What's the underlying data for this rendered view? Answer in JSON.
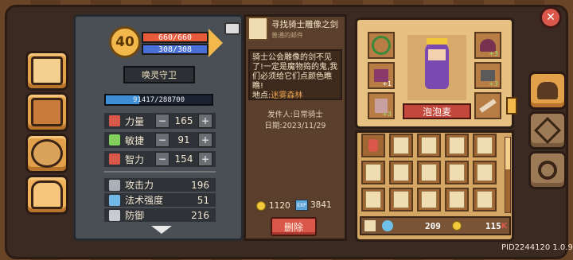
{
  "player": {
    "level": "40",
    "hp": "660/660",
    "mp": "308/308",
    "name": "唤灵守卫",
    "exp_text": "91417/288700",
    "exp_fraction": 0.317
  },
  "attributes": [
    {
      "label": "力量",
      "value": "165",
      "icon": "fist-icon",
      "color": "#d9574b"
    },
    {
      "label": "敏捷",
      "value": "91",
      "icon": "feather-icon",
      "color": "#7fcf5a"
    },
    {
      "label": "智力",
      "value": "154",
      "icon": "book-icon",
      "color": "#d9574b"
    }
  ],
  "combat_stats": [
    {
      "label": "攻击力",
      "value": "196",
      "icon": "sword-icon"
    },
    {
      "label": "法术强度",
      "value": "51",
      "icon": "wand-icon"
    },
    {
      "label": "防御",
      "value": "216",
      "icon": "shield-icon"
    }
  ],
  "quest": {
    "title": "寻找骑士雕像之剑",
    "subtitle": "普通的邮件",
    "body": "骑士公会雕像的剑不见了!一定是魔物捣的鬼,我们必须给它们点颜色瞧瞧!",
    "location_label": "地点:",
    "location": "迷雾森林",
    "sender": "发件人:日常骑士",
    "date": "日期:2023/11/29",
    "gold": "1120",
    "exp": "3841",
    "exp_badge": "EXP",
    "delete_label": "删除"
  },
  "character": {
    "name": "泡泡麦",
    "slot_badges": [
      "+3",
      "+1",
      "+3",
      "+3",
      "+3"
    ]
  },
  "inventory": {
    "gems": "209",
    "gold": "115",
    "gold_suffix": "K"
  },
  "version": "PID2244120 1.0.9",
  "colors": {
    "hp": "#e85a3c",
    "mp": "#4a6fd6",
    "accent": "#e3a04a"
  }
}
